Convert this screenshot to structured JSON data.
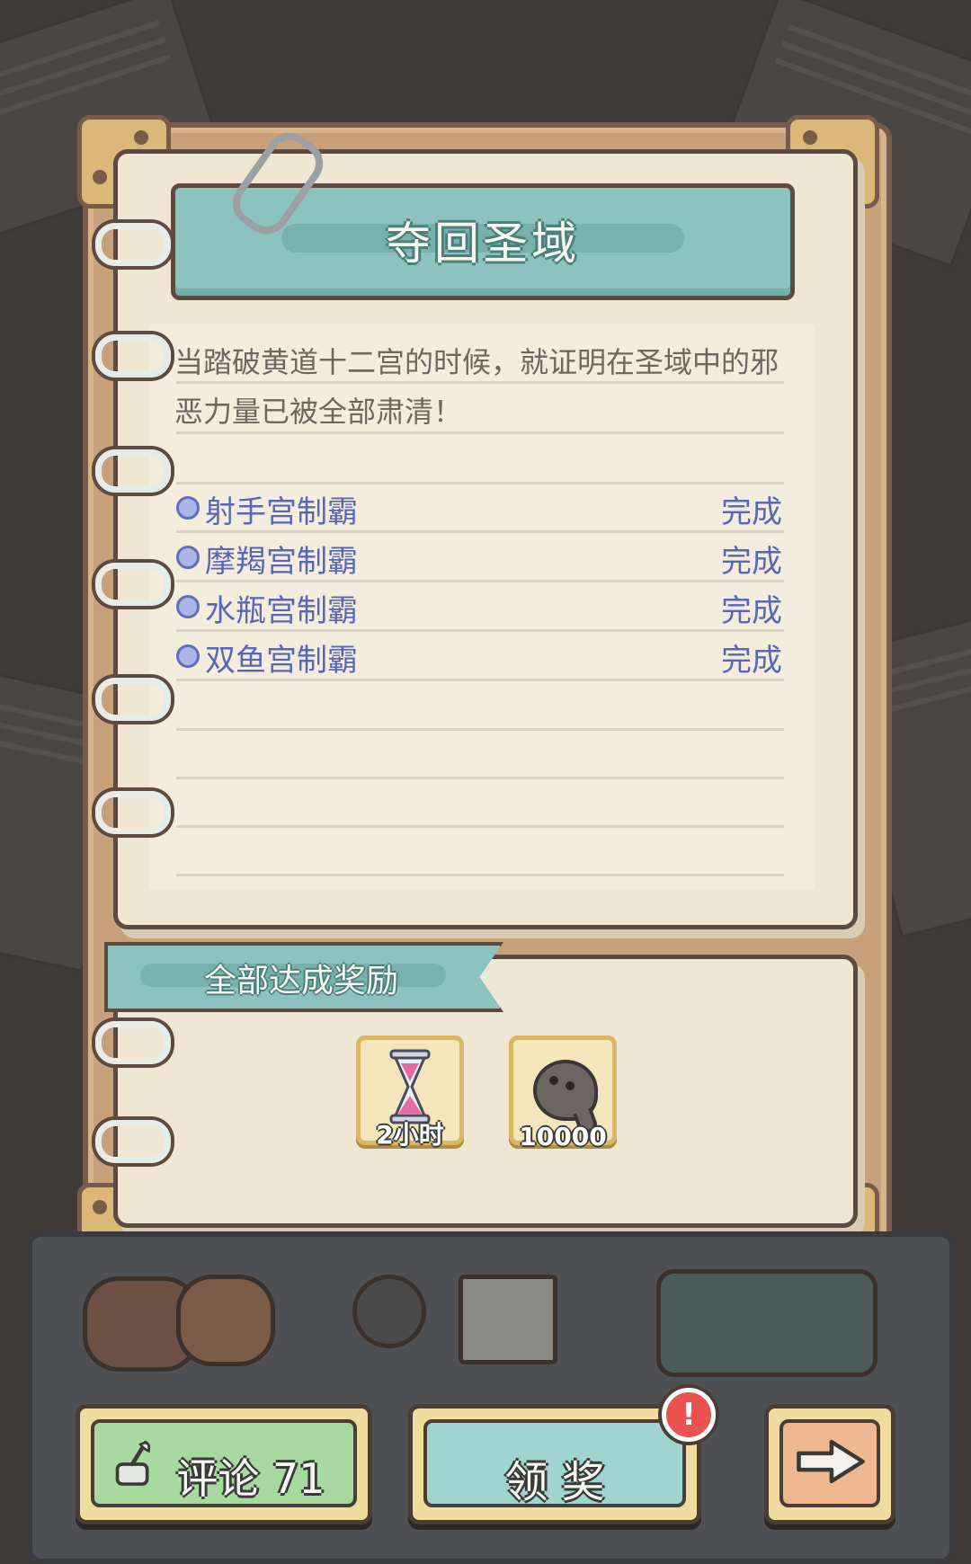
{
  "header": {
    "title": "夺回圣域"
  },
  "description": "当踏破黄道十二宫的时候，就证明在圣域中的邪恶力量已被全部肃清！",
  "tasks": [
    {
      "name": "射手宫制霸",
      "status": "完成"
    },
    {
      "name": "摩羯宫制霸",
      "status": "完成"
    },
    {
      "name": "水瓶宫制霸",
      "status": "完成"
    },
    {
      "name": "双鱼宫制霸",
      "status": "完成"
    }
  ],
  "reward": {
    "title": "全部达成奖励",
    "items": [
      {
        "icon": "hourglass-icon",
        "label": "2小时"
      },
      {
        "icon": "spirit-icon",
        "label": "10000"
      }
    ]
  },
  "buttons": {
    "comment_label": "评论 71",
    "claim_label": "领 奖",
    "claim_badge": "!",
    "next_icon": "arrow-right-icon"
  },
  "colors": {
    "banner": "#8cc3bf",
    "task_text": "#5866b5",
    "comment_button": "#a8d9a0",
    "claim_button": "#9fd4d0",
    "next_button": "#f0b890",
    "badge": "#e85350"
  }
}
